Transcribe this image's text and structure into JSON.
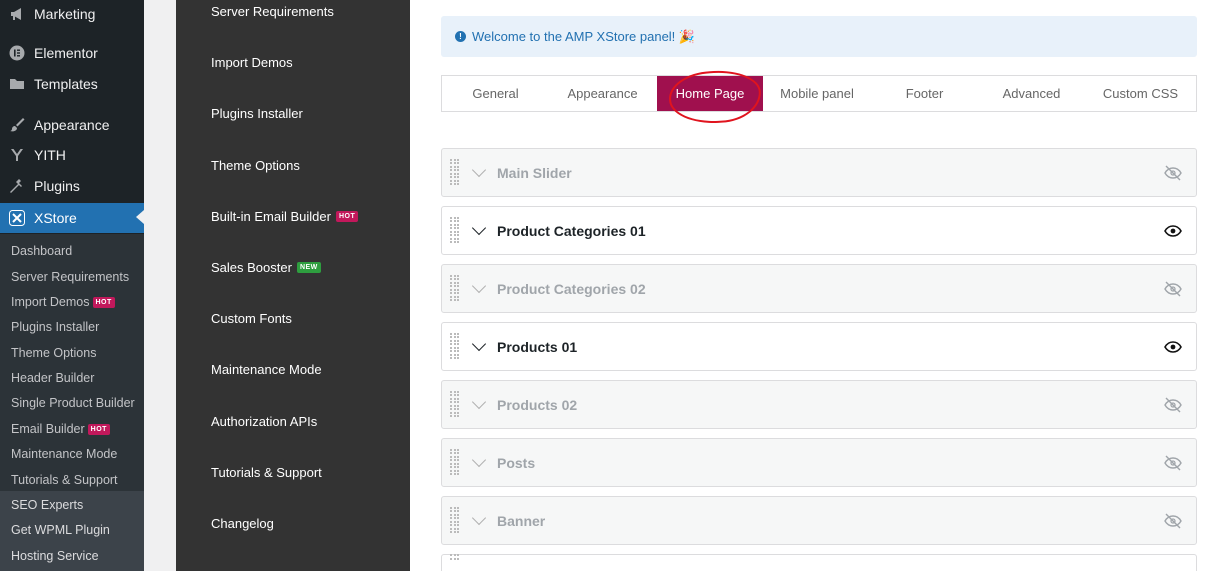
{
  "wp_menu": [
    {
      "label": "Marketing",
      "icon": "megaphone-icon"
    },
    {
      "label": "Elementor",
      "icon": "elementor-icon"
    },
    {
      "label": "Templates",
      "icon": "folder-icon"
    },
    {
      "label": "Appearance",
      "icon": "paintbrush-icon"
    },
    {
      "label": "YITH",
      "icon": "yith-icon"
    },
    {
      "label": "Plugins",
      "icon": "plugin-icon"
    },
    {
      "label": "XStore",
      "icon": "xstore-icon",
      "active": true
    }
  ],
  "wp_submenu": [
    {
      "label": "Dashboard"
    },
    {
      "label": "Server Requirements"
    },
    {
      "label": "Import Demos",
      "badge": "HOT"
    },
    {
      "label": "Plugins Installer"
    },
    {
      "label": "Theme Options"
    },
    {
      "label": "Header Builder"
    },
    {
      "label": "Single Product Builder"
    },
    {
      "label": "Email Builder",
      "badge": "HOT"
    },
    {
      "label": "Maintenance Mode"
    },
    {
      "label": "Tutorials & Support"
    },
    {
      "label": "SEO Experts"
    },
    {
      "label": "Get WPML Plugin"
    },
    {
      "label": "Hosting Service"
    }
  ],
  "xstore_menu": [
    {
      "label": "Server Requirements"
    },
    {
      "label": "Import Demos"
    },
    {
      "label": "Plugins Installer"
    },
    {
      "label": "Theme Options"
    },
    {
      "label": "Built-in Email Builder",
      "badge": "HOT"
    },
    {
      "label": "Sales Booster",
      "badge": "NEW"
    },
    {
      "label": "Custom Fonts"
    },
    {
      "label": "Maintenance Mode"
    },
    {
      "label": "Authorization APIs"
    },
    {
      "label": "Tutorials & Support"
    },
    {
      "label": "Changelog"
    }
  ],
  "notice": {
    "text": "Welcome to the AMP XStore panel! 🎉",
    "icon": "info-icon"
  },
  "tabs": [
    {
      "label": "General"
    },
    {
      "label": "Appearance"
    },
    {
      "label": "Home Page",
      "active": true
    },
    {
      "label": "Mobile panel"
    },
    {
      "label": "Footer"
    },
    {
      "label": "Advanced"
    },
    {
      "label": "Custom CSS"
    }
  ],
  "sections": [
    {
      "title": "Main Slider",
      "visible": false
    },
    {
      "title": "Product Categories 01",
      "visible": true
    },
    {
      "title": "Product Categories 02",
      "visible": false
    },
    {
      "title": "Products 01",
      "visible": true
    },
    {
      "title": "Products 02",
      "visible": false
    },
    {
      "title": "Posts",
      "visible": false
    },
    {
      "title": "Banner",
      "visible": false
    }
  ],
  "colors": {
    "accent": "#a0104e",
    "wp_active": "#2271b1",
    "annotation": "#e0141e"
  }
}
